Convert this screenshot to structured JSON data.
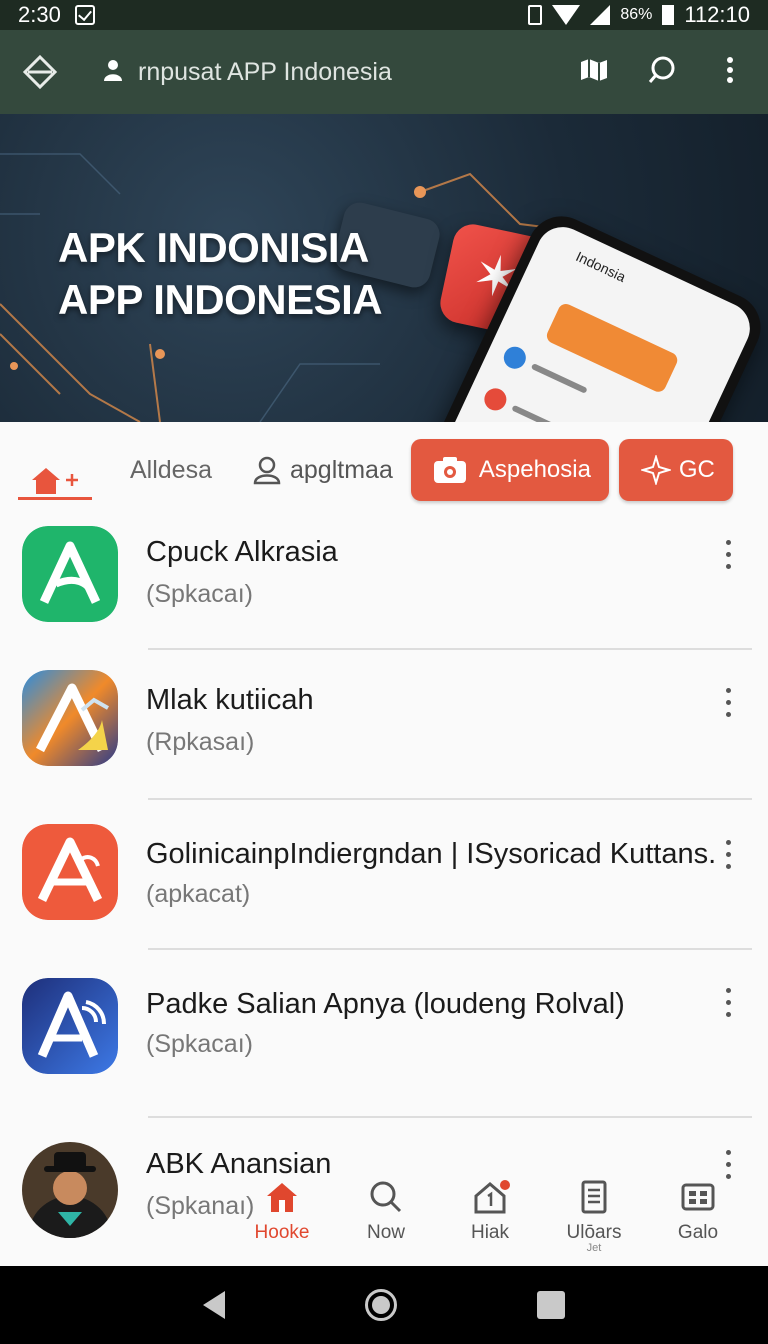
{
  "status_bar": {
    "time": "2:30",
    "battery": "86%",
    "clock_right": "112:10"
  },
  "app_bar": {
    "title": "rnpusat APP Indonesia"
  },
  "banner": {
    "line1": "APK INDONISIA",
    "line2": "APP INDONESIA",
    "phone_title": "Indonsia"
  },
  "tabs": {
    "text_tab": "Alldesa",
    "profile_tab": "apgltmaa",
    "chip_camera": "Aspehosia",
    "chip_gc": "GC"
  },
  "apps": [
    {
      "title": "Cpuck Alkrasia",
      "subtitle": "(Spkacaı)",
      "icon": "a-logo-green-icon",
      "color": "#1fb56b"
    },
    {
      "title": "Mlak kutiicah",
      "subtitle": "(Rpkasaı)",
      "icon": "a-logo-mountain-icon",
      "color": "#2a6fd6"
    },
    {
      "title": "GolinicainpIndiergndan | ISysoricad Kuttans.",
      "subtitle": "(apkacat)",
      "icon": "a-logo-red-icon",
      "color": "#ee5a3c"
    },
    {
      "title": "Padke Salian Apnya (loudeng Rolval)",
      "subtitle": "(Spkacaı)",
      "icon": "a-logo-blue-icon",
      "color": "#2c56c4"
    },
    {
      "title": "ABK Anansian",
      "subtitle": "(Spkanaı)",
      "icon": "avatar-photo-icon",
      "color": "#1f2a24"
    }
  ],
  "bottom_nav": [
    {
      "label": "Hooke",
      "icon": "home-icon",
      "active": true
    },
    {
      "label": "Now",
      "icon": "search-icon"
    },
    {
      "label": "Hiak",
      "icon": "house-badge-icon"
    },
    {
      "label": "Ulōars",
      "sub": "Jet",
      "icon": "document-icon"
    },
    {
      "label": "Galo",
      "icon": "grid-icon"
    }
  ],
  "colors": {
    "accent": "#e35940",
    "app_bar": "#34493d",
    "status_bar": "#1e2b22"
  }
}
